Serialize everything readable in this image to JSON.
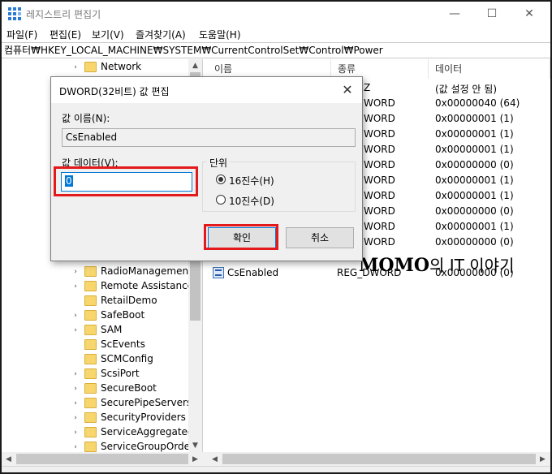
{
  "window": {
    "title": "레지스트리 편집기",
    "minimize_glyph": "—",
    "maximize_glyph": "☐",
    "close_glyph": "✕"
  },
  "menu": [
    {
      "label": "파일(F)"
    },
    {
      "label": "편집(E)"
    },
    {
      "label": "보기(V)"
    },
    {
      "label": "즐겨찾기(A)"
    },
    {
      "label": "도움말(H)"
    }
  ],
  "address": "컴퓨터₩HKEY_LOCAL_MACHINE₩SYSTEM₩CurrentControlSet₩Control₩Power",
  "tree": {
    "items": [
      {
        "label": "Network"
      },
      {
        "label": "RadioManagement"
      },
      {
        "label": "Remote Assistance"
      },
      {
        "label": "RetailDemo"
      },
      {
        "label": "SafeBoot"
      },
      {
        "label": "SAM"
      },
      {
        "label": "ScEvents"
      },
      {
        "label": "SCMConfig"
      },
      {
        "label": "ScsiPort"
      },
      {
        "label": "SecureBoot"
      },
      {
        "label": "SecurePipeServers"
      },
      {
        "label": "SecurityProviders"
      },
      {
        "label": "ServiceAggregatedE"
      },
      {
        "label": "ServiceGroupOrder"
      }
    ]
  },
  "list": {
    "columns": {
      "name": "이름",
      "type": "종류",
      "data": "데이터"
    },
    "rows": [
      {
        "type": "Z",
        "data": "(값 설정 안 됨)"
      },
      {
        "type": "WORD",
        "data": "0x00000040 (64)"
      },
      {
        "type": "WORD",
        "data": "0x00000001 (1)"
      },
      {
        "type": "WORD",
        "data": "0x00000001 (1)"
      },
      {
        "type": "WORD",
        "data": "0x00000001 (1)"
      },
      {
        "type": "WORD",
        "data": "0x00000000 (0)"
      },
      {
        "type": "WORD",
        "data": "0x00000001 (1)"
      },
      {
        "type": "WORD",
        "data": "0x00000001 (1)"
      },
      {
        "type": "WORD",
        "data": "0x00000000 (0)"
      },
      {
        "type": "WORD",
        "data": "0x00000001 (1)"
      },
      {
        "type": "WORD",
        "data": "0x00000000 (0)"
      }
    ],
    "cs_row": {
      "name": "CsEnabled",
      "type": "REG_DWORD",
      "data": "0x00000000 (0)"
    }
  },
  "dialog": {
    "title": "DWORD(32비트) 값 편집",
    "close_glyph": "✕",
    "value_name_label": "값 이름(N):",
    "value_name": "CsEnabled",
    "value_data_label": "값 데이터(V):",
    "value_data": "0",
    "base_group_label": "단위",
    "radio_hex": "16진수(H)",
    "radio_dec": "10진수(D)",
    "ok_label": "확인",
    "cancel_label": "취소",
    "highlight_color": "#e3191b",
    "accent_color": "#0078d7"
  },
  "watermark": {
    "brand": "MOMO",
    "middle": "의 IT ",
    "suffix": "이야기"
  }
}
